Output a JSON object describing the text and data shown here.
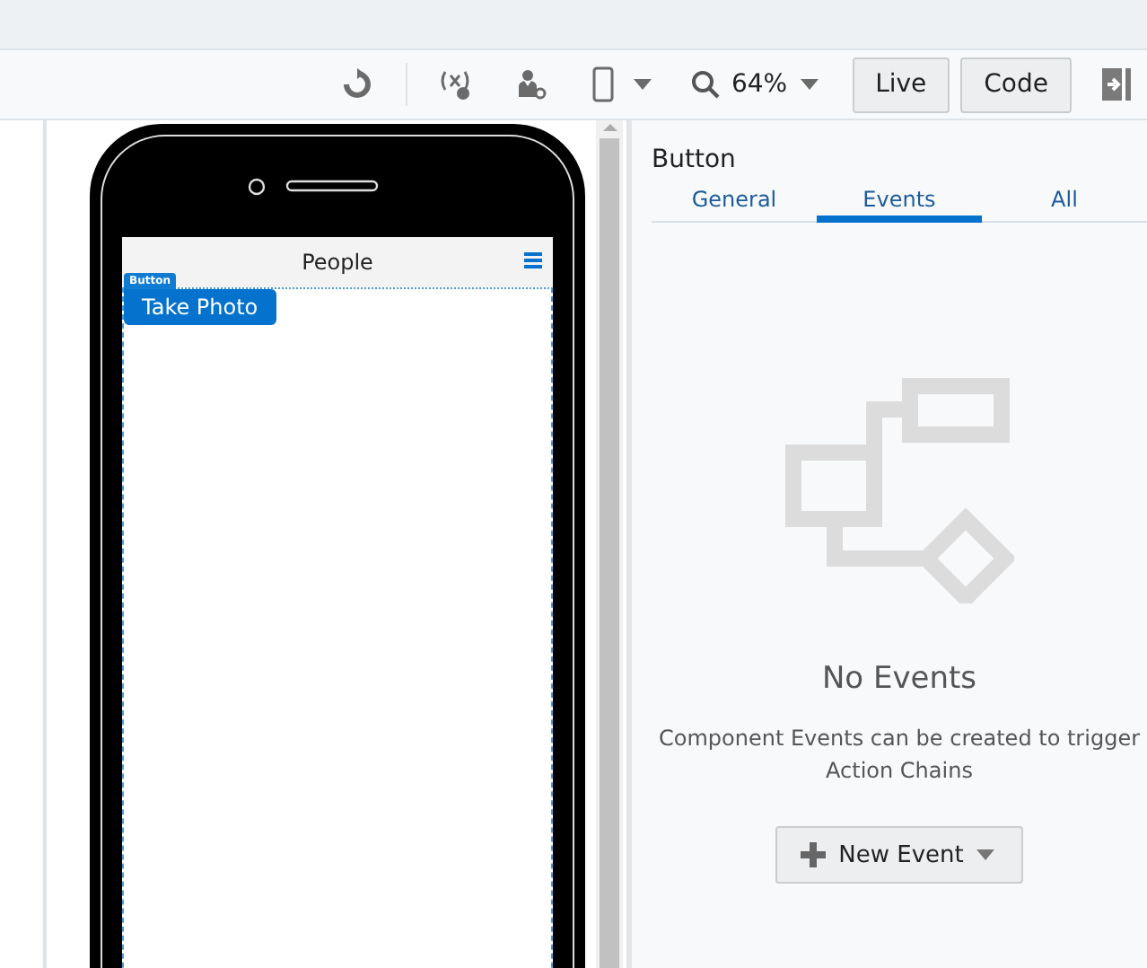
{
  "toolbar": {
    "zoom": "64%",
    "buttons": [
      {
        "label": "Live"
      },
      {
        "label": "Code"
      }
    ]
  },
  "phone": {
    "title": "People",
    "selection_badge": "Button",
    "button": "Take Photo"
  },
  "panel": {
    "title": "Button",
    "tabs": [
      {
        "label": "General",
        "selected": false
      },
      {
        "label": "Events",
        "selected": true
      },
      {
        "label": "All",
        "selected": false
      }
    ],
    "empty_title": "No Events",
    "empty_message": "Component Events can be created to trigger Action Chains",
    "new_event": "New Event"
  }
}
